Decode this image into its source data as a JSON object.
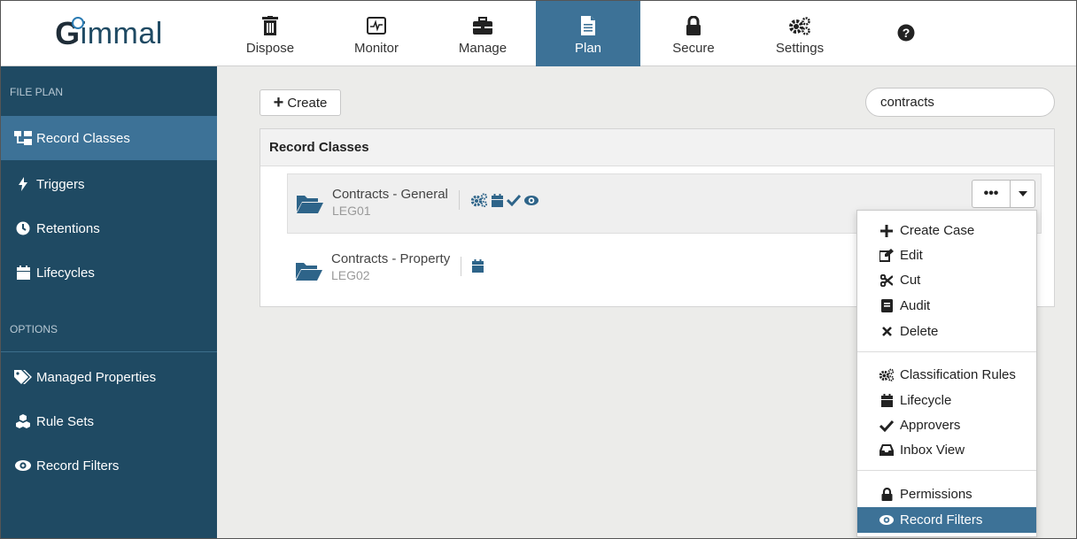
{
  "app": {
    "logo_text_first": "G",
    "logo_text_rest": "immal"
  },
  "nav": {
    "items": [
      {
        "label": "Dispose",
        "icon": "trash-icon"
      },
      {
        "label": "Monitor",
        "icon": "monitor-icon"
      },
      {
        "label": "Manage",
        "icon": "briefcase-icon"
      },
      {
        "label": "Plan",
        "icon": "document-icon",
        "active": true
      },
      {
        "label": "Secure",
        "icon": "lock-icon"
      },
      {
        "label": "Settings",
        "icon": "gears-icon"
      },
      {
        "label": "",
        "icon": "help-icon"
      }
    ]
  },
  "sidebar": {
    "file_plan_heading": "FILE PLAN",
    "file_plan_items": [
      {
        "label": "Record Classes",
        "icon": "sitemap-icon",
        "active": true
      },
      {
        "label": "Triggers",
        "icon": "bolt-icon"
      },
      {
        "label": "Retentions",
        "icon": "clock-icon"
      },
      {
        "label": "Lifecycles",
        "icon": "calendar-icon"
      }
    ],
    "options_heading": "OPTIONS",
    "options_items": [
      {
        "label": "Managed Properties",
        "icon": "tags-icon"
      },
      {
        "label": "Rule Sets",
        "icon": "cubes-icon"
      },
      {
        "label": "Record Filters",
        "icon": "eye-icon"
      }
    ]
  },
  "toolbar": {
    "create_label": "Create",
    "search_value": "contracts"
  },
  "record_classes": {
    "title": "Record Classes",
    "rows": [
      {
        "name": "Contracts - General",
        "code": "LEG01",
        "icons": [
          "gears-icon",
          "calendar-icon",
          "check-icon",
          "eye-icon"
        ]
      },
      {
        "name": "Contracts - Property",
        "code": "LEG02",
        "icons": [
          "calendar-icon"
        ]
      }
    ]
  },
  "row_actions": {
    "more_label": "•••"
  },
  "context_menu": {
    "group1": [
      {
        "label": "Create Case",
        "icon": "plus-icon"
      },
      {
        "label": "Edit",
        "icon": "edit-icon"
      },
      {
        "label": "Cut",
        "icon": "scissors-icon"
      },
      {
        "label": "Audit",
        "icon": "audit-icon"
      },
      {
        "label": "Delete",
        "icon": "times-icon"
      }
    ],
    "group2": [
      {
        "label": "Classification Rules",
        "icon": "gears-icon"
      },
      {
        "label": "Lifecycle",
        "icon": "calendar-icon"
      },
      {
        "label": "Approvers",
        "icon": "check-icon"
      },
      {
        "label": "Inbox View",
        "icon": "inbox-icon"
      }
    ],
    "group3": [
      {
        "label": "Permissions",
        "icon": "lock-icon"
      },
      {
        "label": "Record Filters",
        "icon": "eye-icon",
        "active": true
      }
    ]
  },
  "colors": {
    "sidebar_bg": "#1f4a63",
    "accent": "#3d7297",
    "icon_blue": "#2e6489"
  }
}
